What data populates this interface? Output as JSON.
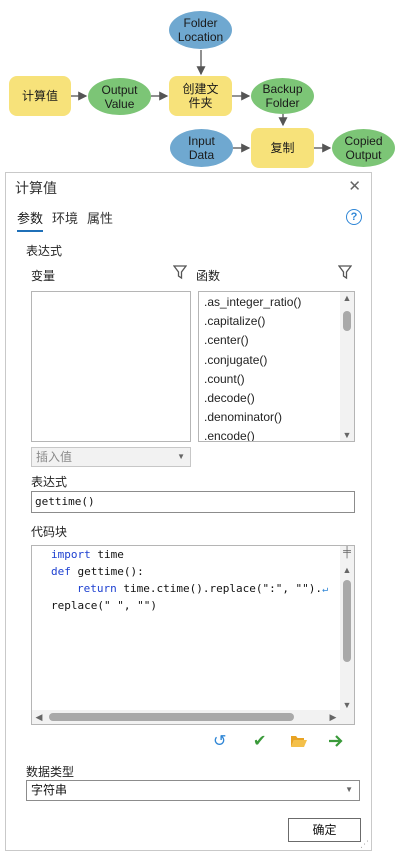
{
  "diagram": {
    "calc_tool": "计算值",
    "output_value": "Output\nValue",
    "folder_location": "Folder\nLocation",
    "create_folder_tool": "创建文\n件夹",
    "backup_folder": "Backup\nFolder",
    "input_data": "Input\nData",
    "copy_tool": "复制",
    "copied_output": "Copied\nOutput"
  },
  "pane": {
    "title": "计算值",
    "close": "✕",
    "tabs": [
      "参数",
      "环境",
      "属性"
    ],
    "help": "?",
    "expression_section": "表达式",
    "variables_label": "变量",
    "functions_label": "函数",
    "functions": [
      ".as_integer_ratio()",
      ".capitalize()",
      ".center()",
      ".conjugate()",
      ".count()",
      ".decode()",
      ".denominator()",
      ".encode()"
    ],
    "insert_value": "插入值",
    "expression_label": "表达式",
    "expression_value": "gettime()",
    "code_block_label": "代码块",
    "code_lines": [
      {
        "kw": "import",
        "rest": " time"
      },
      {
        "kw": "def",
        "rest": " gettime():"
      },
      {
        "kw": "return",
        "rest": " time.ctime().replace(\":\", \"\")."
      },
      {
        "kw": "",
        "rest": "replace(\" \", \"\")"
      }
    ],
    "data_type_label": "数据类型",
    "data_type_value": "字符串",
    "ok_label": "确定"
  },
  "colors": {
    "tool_yellow": "#f7e27a",
    "variable_blue": "#6fa8d0",
    "output_green": "#7cc576",
    "accent_blue": "#1f70b8"
  }
}
